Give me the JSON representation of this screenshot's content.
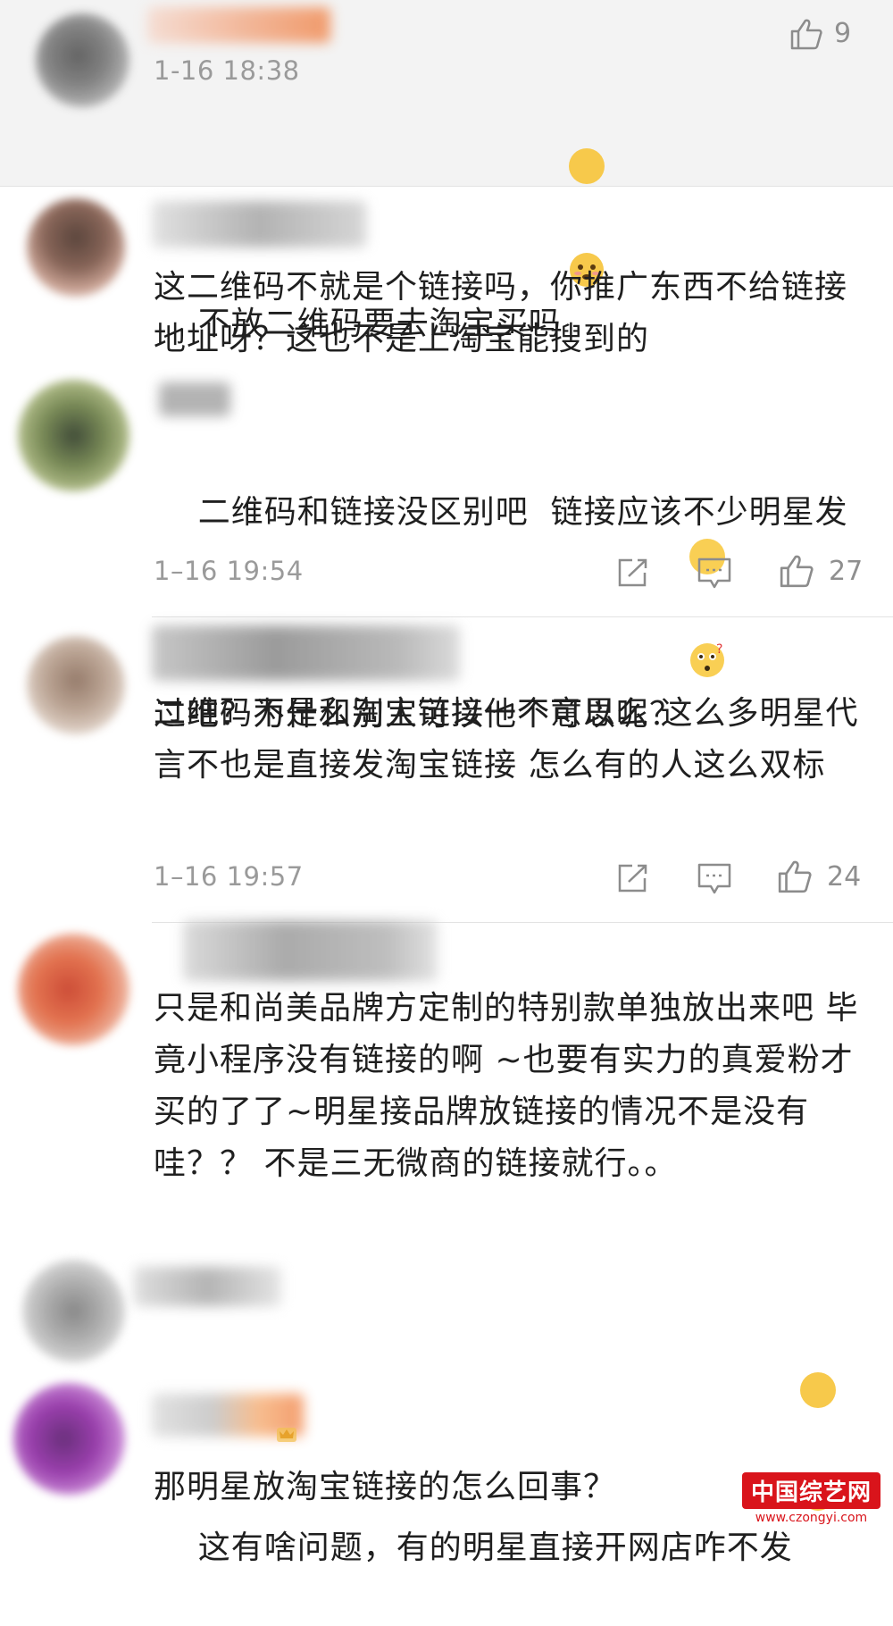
{
  "comments": [
    {
      "time": "1-16 18:38",
      "likes": "9",
      "text": "不放二维码要去淘宝买吗"
    },
    {
      "text": "这二维码不就是个链接吗，你推广东西不给链接地址呀？这也不是上淘宝能搜到的"
    },
    {
      "time": "1–16 19:54",
      "likes": "27",
      "text": "二维码和链接没区别吧  链接应该不少明星发过吧？为什么别人可以他不可以呢？"
    },
    {
      "time": "1–16 19:57",
      "likes": "24",
      "text": "二维码不是和淘宝链接一个意思么 这么多明星代言不也是直接发淘宝链接 怎么有的人这么双标"
    },
    {
      "text": "只是和尚美品牌方定制的特别款单独放出来吧 毕竟小程序没有链接的啊 ~也要有实力的真爱粉才买的了了~明星接品牌放链接的情况不是没有哇？？ 不是三无微商的链接就行。。"
    },
    {
      "text": "这有啥问题，有的明星直接开网店咋不发"
    },
    {
      "text": "那明星放淘宝链接的怎么回事？"
    }
  ],
  "watermark": {
    "name": "中国综艺网",
    "url": "www.czongyi.com"
  },
  "icons": [
    "thumbs-up-icon",
    "share-icon",
    "comment-icon",
    "emoji-icon"
  ],
  "colors": {
    "highlight_background": "#f3f3f3",
    "meta_gray": "#9a9a9a",
    "watermark_red": "#d9141b"
  }
}
